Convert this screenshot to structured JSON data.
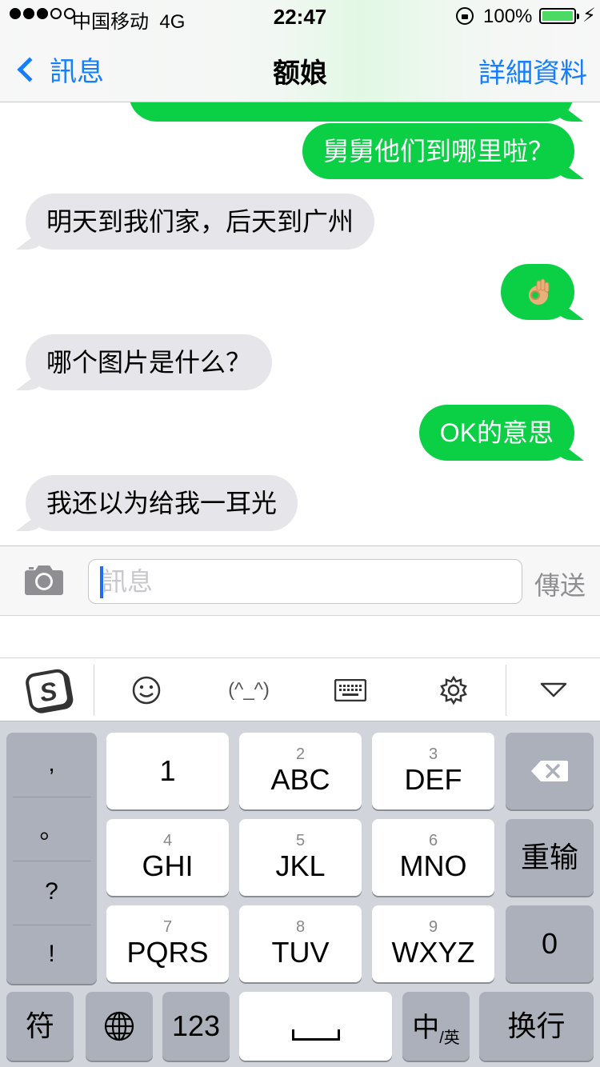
{
  "status_bar": {
    "carrier": "中国移动",
    "network": "4G",
    "time": "22:47",
    "battery_percent": "100%",
    "battery_level": 1.0,
    "signal_bars_filled": 3,
    "signal_bars_total": 5,
    "charging_icon": "bolt-icon",
    "battery_color": "#4cd964"
  },
  "nav": {
    "back_label": "訊息",
    "title": "额娘",
    "details_label": "詳細資料",
    "accent_color": "#157efb"
  },
  "messages": [
    {
      "side": "sent",
      "text": "舅舅他们到哪里啦？"
    },
    {
      "side": "received",
      "text": "明天到我们家，后天到广州"
    },
    {
      "side": "sent",
      "text": "",
      "emoji": "ok-hand-icon"
    },
    {
      "side": "received",
      "text": "哪个图片是什么？"
    },
    {
      "side": "sent",
      "text": "OK的意思"
    },
    {
      "side": "received",
      "text": "我还以为给我一耳光"
    }
  ],
  "composer": {
    "placeholder": "訊息",
    "send_label": "傳送"
  },
  "ime_toolbar": {
    "items": [
      "sogou-logo-icon",
      "emoji-face-icon",
      "kaomoji",
      "keyboard-icon",
      "gear-icon",
      "hide-keyboard-icon"
    ],
    "kaomoji_label": "(^_^)"
  },
  "keyboard": {
    "punctuation": [
      ",",
      "。",
      "?",
      "!"
    ],
    "keys": [
      {
        "num": "",
        "label": "1"
      },
      {
        "num": "2",
        "label": "ABC"
      },
      {
        "num": "3",
        "label": "DEF"
      },
      {
        "num": "4",
        "label": "GHI"
      },
      {
        "num": "5",
        "label": "JKL"
      },
      {
        "num": "6",
        "label": "MNO"
      },
      {
        "num": "7",
        "label": "PQRS"
      },
      {
        "num": "8",
        "label": "TUV"
      },
      {
        "num": "9",
        "label": "WXYZ"
      }
    ],
    "retype_label": "重输",
    "zero_label": "0",
    "symbols_label": "符",
    "numbers_label": "123",
    "lang_main": "中",
    "lang_sub": "英",
    "return_label": "换行"
  },
  "colors": {
    "sent_bubble": "#0bd046",
    "received_bubble": "#e5e5ea"
  }
}
